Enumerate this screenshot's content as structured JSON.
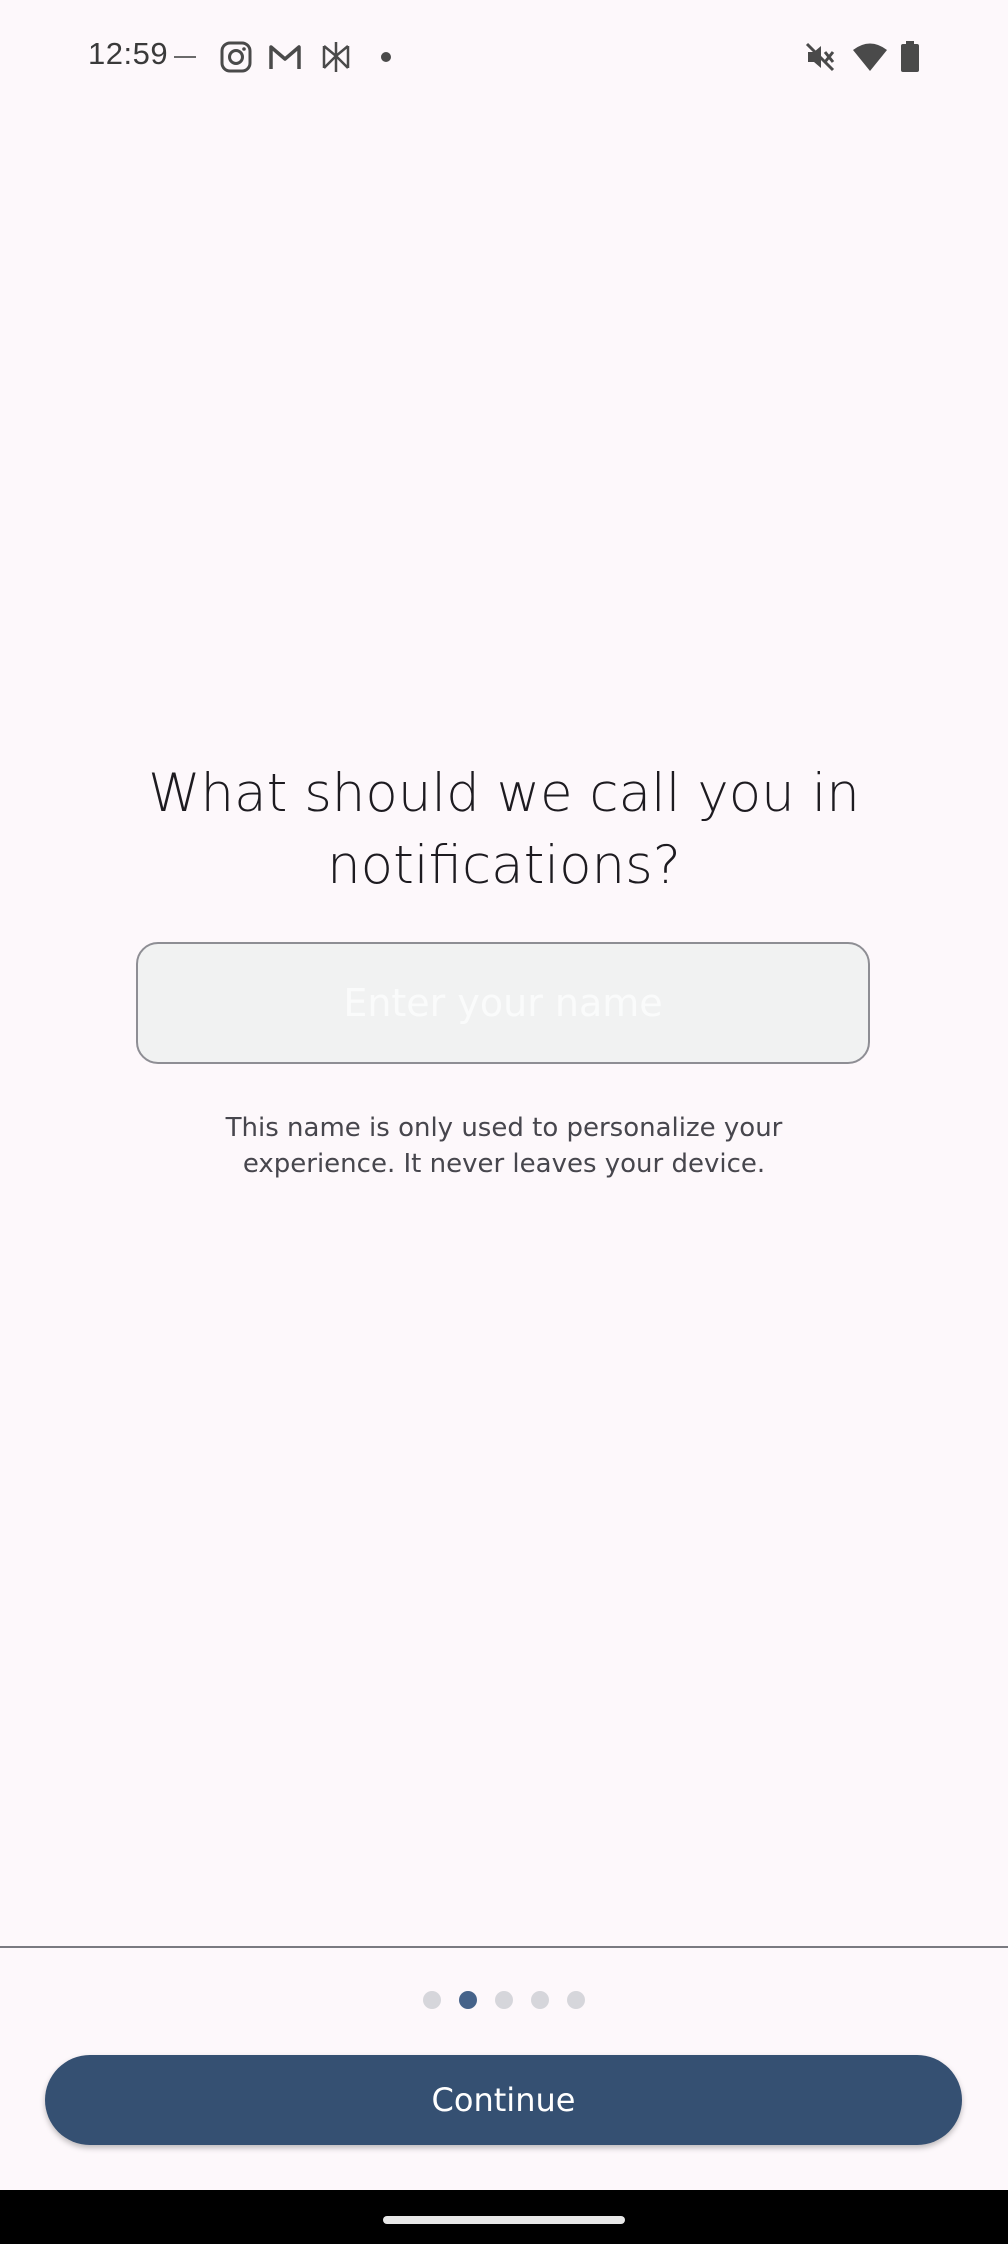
{
  "status_bar": {
    "time": "12:59",
    "icons": [
      "music-note-icon",
      "instagram-icon",
      "gmail-icon",
      "app-icon",
      "dot-icon",
      "mute-icon",
      "wifi-icon",
      "battery-icon"
    ]
  },
  "onboarding": {
    "title": "What should we call you in notifications?",
    "name_field": {
      "placeholder": "Enter your name",
      "value": ""
    },
    "helper_text": "This name is only used to personalize your experience. It never leaves your device.",
    "pages": 5,
    "current_page": 2,
    "continue_label": "Continue"
  },
  "colors": {
    "background": "#fdf8fb",
    "button": "#355072",
    "active_dot": "#46638a",
    "inactive_dot": "#d6d6db"
  }
}
